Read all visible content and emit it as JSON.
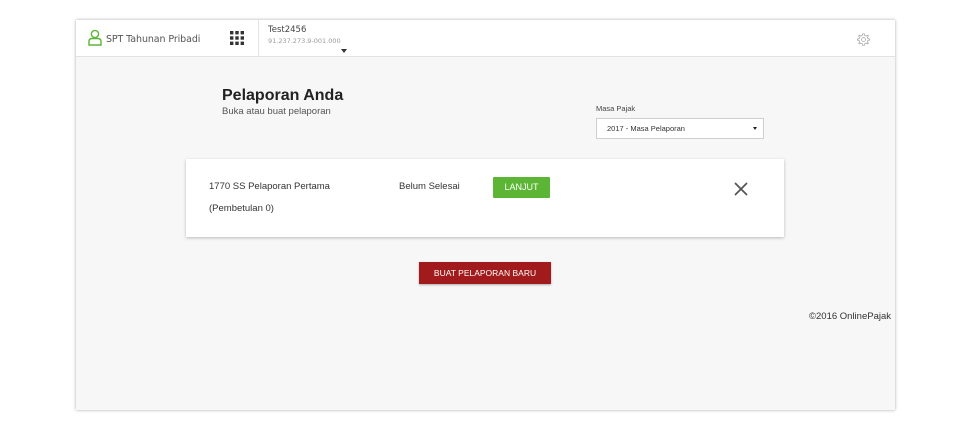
{
  "app": {
    "title": "SPT Tahunan Pribadi"
  },
  "account": {
    "name": "Test2456",
    "npwp": "91.237.273.9-001.000"
  },
  "page": {
    "title": "Pelaporan Anda",
    "subtitle": "Buka atau buat pelaporan"
  },
  "filter": {
    "label": "Masa Pajak",
    "selected": "2017 - Masa Pelaporan"
  },
  "report": {
    "title": "1770 SS Pelaporan Pertama",
    "subtitle": "(Pembetulan 0)",
    "status": "Belum Selesai",
    "continue_label": "LANJUT"
  },
  "actions": {
    "new_report_label": "BUAT PELAPORAN BARU"
  },
  "footer": {
    "copyright": "©2016 OnlinePajak"
  },
  "icons": {
    "brand": "user-icon",
    "apps": "apps-grid-icon",
    "account_menu": "caret-down-icon",
    "settings": "gear-icon",
    "remove": "close-icon"
  },
  "colors": {
    "continue_button": "#5cb535",
    "new_report_button": "#a11a1c",
    "brand_icon": "#5cb535"
  }
}
